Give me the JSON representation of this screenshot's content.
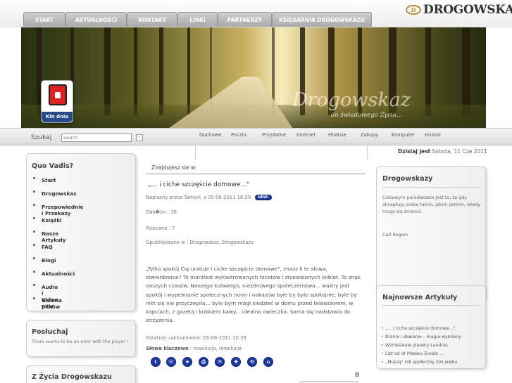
{
  "nav": {
    "tabs": [
      {
        "label": "START"
      },
      {
        "label": "AKTUALNOŚCI"
      },
      {
        "label": "KONTAKT"
      },
      {
        "label": "LINKI"
      },
      {
        "label": "PARTNERZY"
      },
      {
        "label": "KSIĘGARNIA DROGOWSKAZU"
      }
    ]
  },
  "logo": {
    "emblem": "D",
    "text": "DROGOWSKAZ"
  },
  "banner": {
    "title": "Drogowskaz",
    "subtitle": "do świadomego Życia..."
  },
  "kin_dnia": {
    "label": "Kin dnia"
  },
  "search": {
    "label": "Szukaj",
    "placeholder": "search",
    "button": "›"
  },
  "categories": [
    "Duchowe",
    "Poczta",
    "Przydatne",
    "Internet",
    "Finanse",
    "Zakupy",
    "Komputer",
    "Humor"
  ],
  "date": {
    "label": "Dzisiaj jest",
    "value": "Sobota, 11 Cze 2011"
  },
  "left": {
    "menu_title": "Quo Vadis?",
    "menu": [
      "Start",
      "Drogowskaz",
      "Przepowiednie i Przekazy",
      "Książki",
      "Nasze Artykuły",
      "FAQ",
      "Blogi",
      "Aktualności",
      "Audio i Video new",
      "Galeria plików"
    ],
    "listen_title": "Posłuchaj",
    "listen_text": "There seems to be an error with the player !",
    "life_title": "Z Życia Drogowskazu"
  },
  "content": {
    "breadcrumb": "Znajdujesz sie w:",
    "title": "„... i ciche szczęście domowe...\"",
    "byline": "Napisany przez Tamiell, z 05-06-2011 10:39",
    "new_badge": "NEW!",
    "views": "Ods�on : 38",
    "recommended": "Polecane : 7",
    "published": "Opublikowane w : Drogowskaz, Drogowskazy",
    "body": "„Tylko spokój Cię uratuje i ciche szczęście domowe\", znasz li te słowa, stwierdzenie? To manifest wykastrowanych facetów i zniewolonych kobiet. To znak naszych czasów. Naszego kulawego, niezdrowego społeczeństwa... ważny jest spokój i wypełnianie społecznych norm i nakazów byle by było spokojnie, byle by nikt się nie przyczepiła... byle bym mógł siedzieć w domu przed telewizorem, w kapciach, z gazetą i kubkiem kawy... idealna owieczka. Sama się nadstawia do strzyżenia.",
    "updated": "Ostatnie uaktualnienie: 05-06-2011 10:39",
    "keywords_label": "Słowa kluczowe",
    "keywords": " : rewolucja, rewolucje",
    "small_icon": "▣"
  },
  "right": {
    "box1_title": "Drogowskazy",
    "quote": "Ciekawym paradoksem jest to, że gdy akceptuję siebie takim, jakim jestem, wtedy mogę się zmienić.",
    "quote_author": "Carl Rogers",
    "box2_title": "Najnowsze Artykuły",
    "articles": [
      "„... i ciche szczęście domowe...\"",
      "Branie i dawanie – magia wymiany",
      "Wznieśienie planety Landras",
      "List od dr Masaru Emoto ...",
      "„Muszą\" rok społeczny XXI wieku"
    ]
  },
  "tools": [
    "ℹ",
    "☏",
    "★",
    "⎙",
    "✉",
    "✚",
    "⟲",
    "⌂"
  ]
}
